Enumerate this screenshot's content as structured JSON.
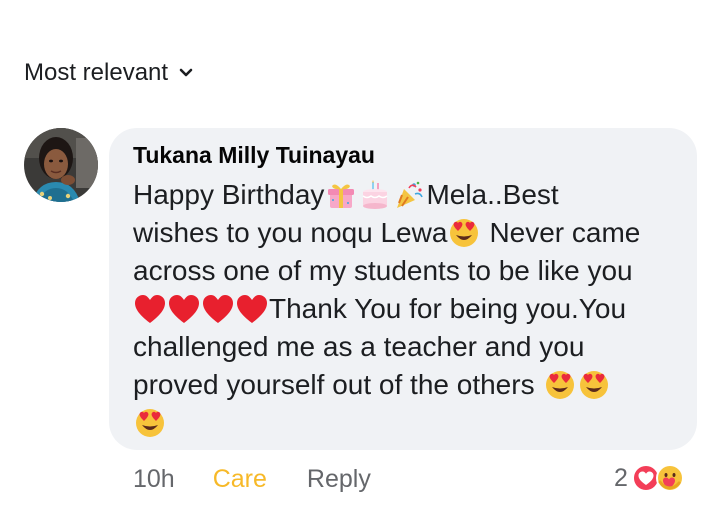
{
  "sort": {
    "label": "Most relevant",
    "icon": "chevron-down-icon"
  },
  "comment": {
    "author": "Tukana Milly Tuinayau",
    "lines": [
      [
        "Happy Birthday",
        "Mela..Best"
      ],
      [
        "wishes to you noqu Lewa",
        "Never came"
      ],
      [
        "across one of my students to be like you"
      ],
      [
        "Thank You for being you.You"
      ],
      [
        "challenged me as a teacher and you"
      ],
      [
        "proved yourself out of the others"
      ]
    ],
    "emojis": {
      "line1": [
        "gift-icon",
        "birthday-cake-icon",
        "party-popper-icon"
      ],
      "line2": [
        "heart-eyes-icon"
      ],
      "line4": [
        "red-heart-icon",
        "red-heart-icon",
        "red-heart-icon",
        "red-heart-icon"
      ],
      "line6": [
        "heart-eyes-icon",
        "heart-eyes-icon"
      ],
      "line7": [
        "heart-eyes-icon"
      ]
    }
  },
  "actions": {
    "time": "10h",
    "reaction_label": "Care",
    "reply_label": "Reply"
  },
  "reactions": {
    "count": "2",
    "icons": [
      "love-reaction-icon",
      "care-reaction-icon"
    ]
  },
  "colors": {
    "care": "#f7b928",
    "bubble": "#f0f2f5",
    "love": "#f33e58"
  }
}
